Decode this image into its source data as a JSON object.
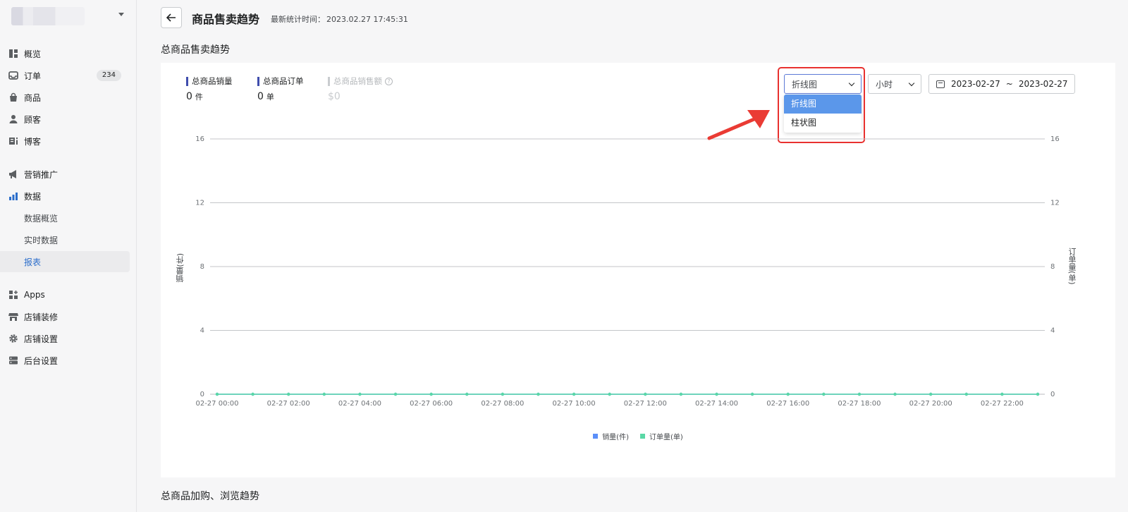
{
  "sidebar": {
    "items": [
      {
        "label": "概览",
        "icon": "overview-icon"
      },
      {
        "label": "订单",
        "icon": "inbox-icon",
        "badge": "234"
      },
      {
        "label": "商品",
        "icon": "bag-icon"
      },
      {
        "label": "顾客",
        "icon": "person-icon"
      },
      {
        "label": "博客",
        "icon": "blog-icon"
      },
      {
        "label": "营销推广",
        "icon": "megaphone-icon"
      },
      {
        "label": "数据",
        "icon": "bar-chart-icon"
      },
      {
        "label": "Apps",
        "icon": "apps-icon"
      },
      {
        "label": "店铺装修",
        "icon": "store-icon"
      },
      {
        "label": "店铺设置",
        "icon": "gear-icon"
      },
      {
        "label": "后台设置",
        "icon": "server-icon"
      }
    ],
    "data_sub": [
      "数据概览",
      "实时数据",
      "报表"
    ]
  },
  "header": {
    "title": "商品售卖趋势",
    "stat_label": "最新统计时间：",
    "stat_time": "2023.02.27 17:45:31"
  },
  "section1_title": "总商品售卖趋势",
  "section2_title": "总商品加购、浏览趋势",
  "metrics": [
    {
      "label": "总商品销量",
      "value": "0",
      "unit": "件"
    },
    {
      "label": "总商品订单",
      "value": "0",
      "unit": "单"
    },
    {
      "label": "总商品销售额",
      "value": "$0",
      "unit": ""
    }
  ],
  "controls": {
    "chart_type": "折线图",
    "chart_type_options": [
      "折线图",
      "柱状图"
    ],
    "granularity": "小时",
    "date_start": "2023-02-27",
    "date_sep": "~",
    "date_end": "2023-02-27"
  },
  "colors": {
    "accent": "#2c6ecb",
    "sales_series": "#5b8ff9",
    "orders_series": "#5ad8a6",
    "annotation": "#e8312f",
    "metric_bar": "#3f4dad"
  },
  "chart_data": {
    "type": "line",
    "categories": [
      "02-27 00:00",
      "02-27 01:00",
      "02-27 02:00",
      "02-27 03:00",
      "02-27 04:00",
      "02-27 05:00",
      "02-27 06:00",
      "02-27 07:00",
      "02-27 08:00",
      "02-27 09:00",
      "02-27 10:00",
      "02-27 11:00",
      "02-27 12:00",
      "02-27 13:00",
      "02-27 14:00",
      "02-27 15:00",
      "02-27 16:00",
      "02-27 17:00",
      "02-27 18:00",
      "02-27 19:00",
      "02-27 20:00",
      "02-27 21:00",
      "02-27 22:00",
      "02-27 23:00"
    ],
    "tick_labels": [
      "02-27 00:00",
      "02-27 02:00",
      "02-27 04:00",
      "02-27 06:00",
      "02-27 08:00",
      "02-27 10:00",
      "02-27 12:00",
      "02-27 14:00",
      "02-27 16:00",
      "02-27 18:00",
      "02-27 20:00",
      "02-27 22:00"
    ],
    "series": [
      {
        "name": "销量(件)",
        "axis": "left",
        "values": [
          0,
          0,
          0,
          0,
          0,
          0,
          0,
          0,
          0,
          0,
          0,
          0,
          0,
          0,
          0,
          0,
          0,
          0,
          0,
          0,
          0,
          0,
          0,
          0
        ]
      },
      {
        "name": "订单量(单)",
        "axis": "right",
        "values": [
          0,
          0,
          0,
          0,
          0,
          0,
          0,
          0,
          0,
          0,
          0,
          0,
          0,
          0,
          0,
          0,
          0,
          0,
          0,
          0,
          0,
          0,
          0,
          0
        ]
      }
    ],
    "y_ticks": [
      0,
      4,
      8,
      12,
      16
    ],
    "ylim": [
      0,
      16
    ],
    "ylabel": "销量(件)",
    "ylabel_right": "订单量(单)",
    "grid": true,
    "legend": "bottom"
  }
}
